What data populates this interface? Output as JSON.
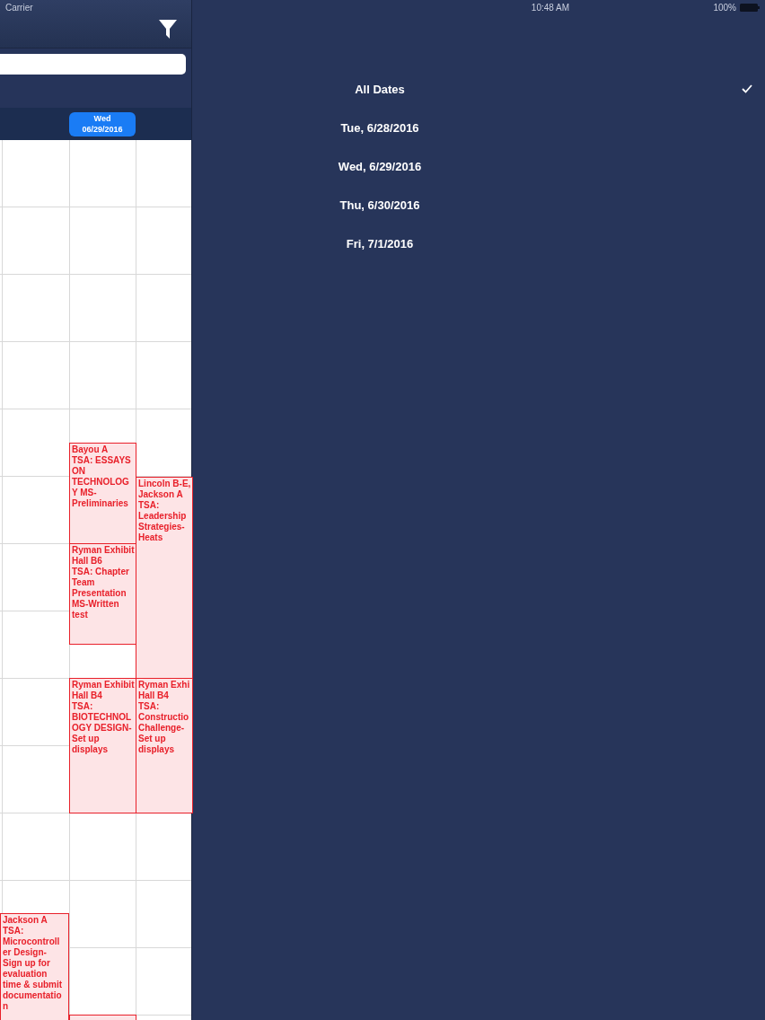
{
  "status_bar": {
    "carrier": "Carrier",
    "time": "10:48 AM",
    "battery": "100%"
  },
  "date_header": {
    "day": "Wed",
    "date": "06/29/2016",
    "selected": true
  },
  "events": [
    {
      "text": "Bayou A\nTSA: ESSAYS\nON\nTECHNOLOG\nY MS-\nPreliminaries"
    },
    {
      "text": "Lincoln B-E,\nJackson A\nTSA:\nLeadership\nStrategies-\nHeats"
    },
    {
      "text": "Ryman Exhibit\nHall B6\nTSA: Chapter\nTeam\nPresentation\nMS-Written\ntest"
    },
    {
      "text": "Ryman Exhibit\nHall B4\nTSA:\nBIOTECHNOL\nOGY DESIGN-\nSet up\ndisplays"
    },
    {
      "text": "Ryman Exhi\nHall B4\nTSA:\nConstructio\nChallenge-\nSet up\ndisplays"
    },
    {
      "text": "Jackson A\nTSA:\nMicrocontroll\ner Design-\nSign up for\nevaluation\ntime & submit\ndocumentatio\nn"
    }
  ],
  "date_filter": [
    {
      "label": "All Dates",
      "selected": true
    },
    {
      "label": "Tue, 6/28/2016",
      "selected": false
    },
    {
      "label": "Wed, 6/29/2016",
      "selected": false
    },
    {
      "label": "Thu, 6/30/2016",
      "selected": false
    },
    {
      "label": "Fri, 7/1/2016",
      "selected": false
    }
  ]
}
